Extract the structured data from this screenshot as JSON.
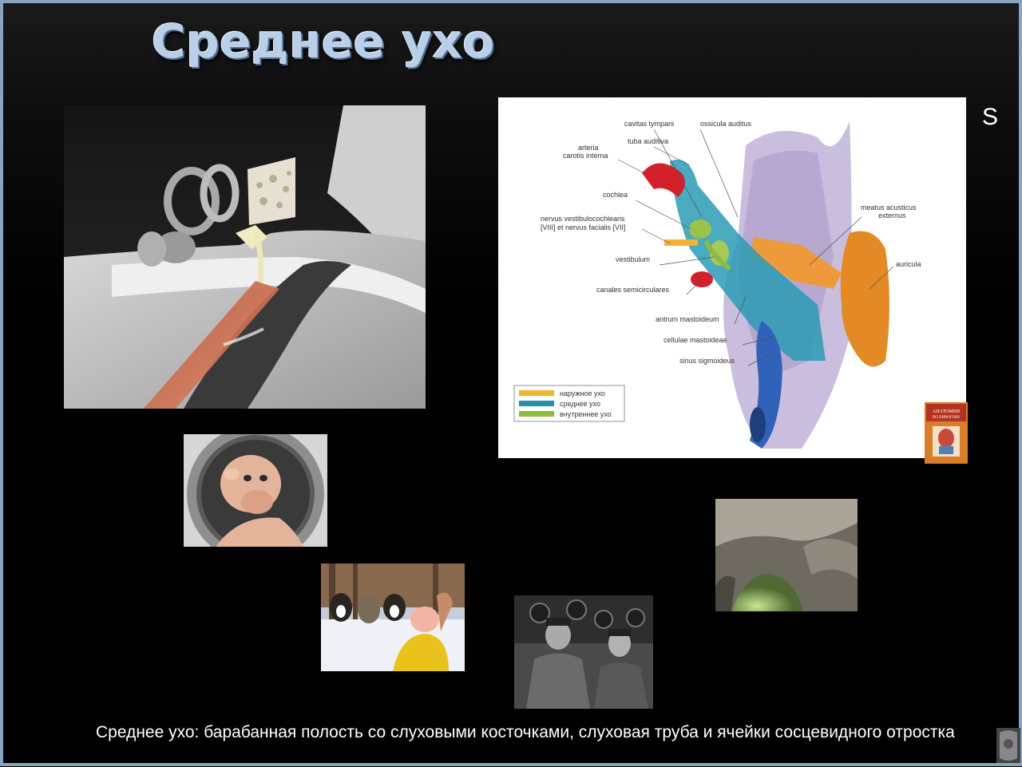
{
  "slide": {
    "title": "Среднее ухо",
    "side_letter": "S",
    "caption": "Среднее ухо: барабанная полость со слуховыми косточками, слуховая труба и ячейки сосцевидного отростка"
  },
  "diagram": {
    "labels_left": {
      "cavitas_tympani": "cavitas tympani",
      "ossicula": "ossicula auditus",
      "tuba": "tuba auditiva",
      "arteria_1": "arteria",
      "arteria_2": "carotis interna",
      "cochlea": "cochlea",
      "nervus_1": "nervus vestibulocochlearis",
      "nervus_2": "[VIII] et nervus facialis [VII]",
      "vestibulum": "vestibulum",
      "canales": "canales semicirculares",
      "antrum": "antrum mastoideum",
      "cellulae": "cellulae mastoideae",
      "sinus": "sinus sigmoideus"
    },
    "labels_right": {
      "meatus_1": "meatus acusticus",
      "meatus_2": "externus",
      "auricula": "auricula"
    },
    "legend": [
      {
        "label": "наружное ухо",
        "color": "#f2b233"
      },
      {
        "label": "среднее ухо",
        "color": "#2a8fa8"
      },
      {
        "label": "внутреннее ухо",
        "color": "#8dbb3a"
      }
    ],
    "book_title": "АНАТОМИЯ ПО ПИРОГОВУ"
  }
}
